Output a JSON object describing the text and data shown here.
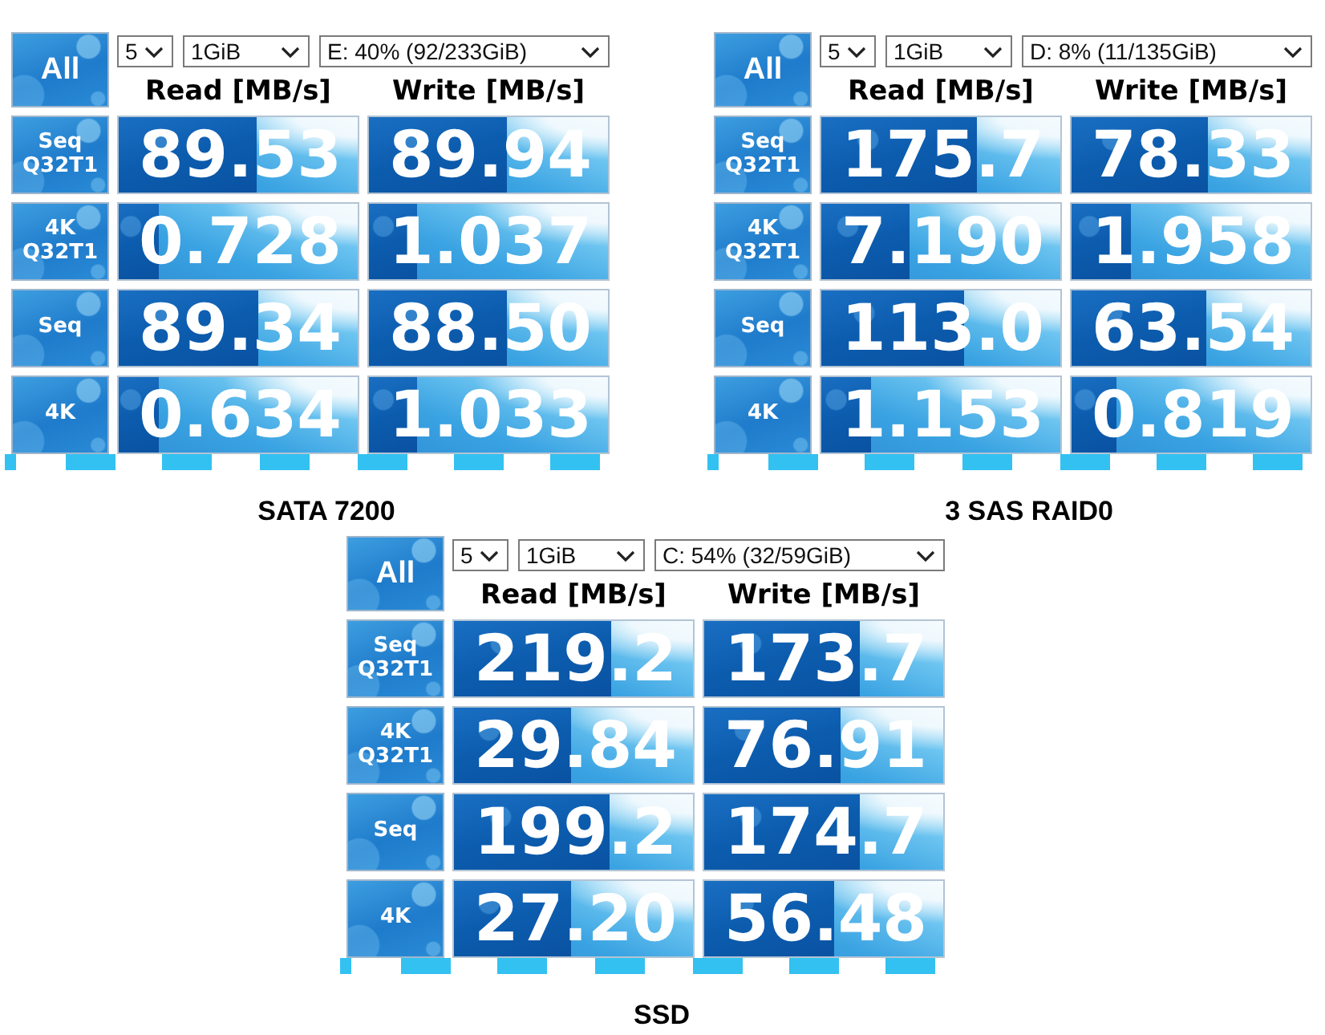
{
  "panels": [
    {
      "all_button": "All",
      "settings": {
        "count": "5",
        "size": "1GiB",
        "drive": "E: 40% (92/233GiB)"
      },
      "columns": [
        "Read [MB/s]",
        "Write [MB/s]"
      ],
      "rows": [
        {
          "test": [
            "Seq",
            "Q32T1"
          ],
          "read": {
            "value": "89.53",
            "level": 0.58
          },
          "write": {
            "value": "89.94",
            "level": 0.58
          }
        },
        {
          "test": [
            "4K",
            "Q32T1"
          ],
          "read": {
            "value": "0.728",
            "level": 0.165
          },
          "write": {
            "value": "1.037",
            "level": 0.2
          }
        },
        {
          "test": [
            "Seq"
          ],
          "read": {
            "value": "89.34",
            "level": 0.585
          },
          "write": {
            "value": "88.50",
            "level": 0.58
          }
        },
        {
          "test": [
            "4K"
          ],
          "read": {
            "value": "0.634",
            "level": 0.165
          },
          "write": {
            "value": "1.033",
            "level": 0.2
          }
        }
      ],
      "caption": "SATA 7200"
    },
    {
      "all_button": "All",
      "settings": {
        "count": "5",
        "size": "1GiB",
        "drive": "D: 8% (11/135GiB)"
      },
      "columns": [
        "Read [MB/s]",
        "Write [MB/s]"
      ],
      "rows": [
        {
          "test": [
            "Seq",
            "Q32T1"
          ],
          "read": {
            "value": "175.7",
            "level": 0.65
          },
          "write": {
            "value": "78.33",
            "level": 0.57
          }
        },
        {
          "test": [
            "4K",
            "Q32T1"
          ],
          "read": {
            "value": "7.190",
            "level": 0.37
          },
          "write": {
            "value": "1.958",
            "level": 0.25
          }
        },
        {
          "test": [
            "Seq"
          ],
          "read": {
            "value": "113.0",
            "level": 0.6
          },
          "write": {
            "value": "63.54",
            "level": 0.565
          }
        },
        {
          "test": [
            "4K"
          ],
          "read": {
            "value": "1.153",
            "level": 0.21
          },
          "write": {
            "value": "0.819",
            "level": 0.19
          }
        }
      ],
      "caption": "3 SAS RAID0"
    },
    {
      "all_button": "All",
      "settings": {
        "count": "5",
        "size": "1GiB",
        "drive": "C: 54% (32/59GiB)"
      },
      "columns": [
        "Read [MB/s]",
        "Write [MB/s]"
      ],
      "rows": [
        {
          "test": [
            "Seq",
            "Q32T1"
          ],
          "read": {
            "value": "219.2",
            "level": 0.66
          },
          "write": {
            "value": "173.7",
            "level": 0.65
          }
        },
        {
          "test": [
            "4K",
            "Q32T1"
          ],
          "read": {
            "value": "29.84",
            "level": 0.49
          },
          "write": {
            "value": "76.91",
            "level": 0.57
          }
        },
        {
          "test": [
            "Seq"
          ],
          "read": {
            "value": "199.2",
            "level": 0.65
          },
          "write": {
            "value": "174.7",
            "level": 0.65
          }
        },
        {
          "test": [
            "4K"
          ],
          "read": {
            "value": "27.20",
            "level": 0.49
          },
          "write": {
            "value": "56.48",
            "level": 0.545
          }
        }
      ],
      "caption": "SSD"
    }
  ]
}
